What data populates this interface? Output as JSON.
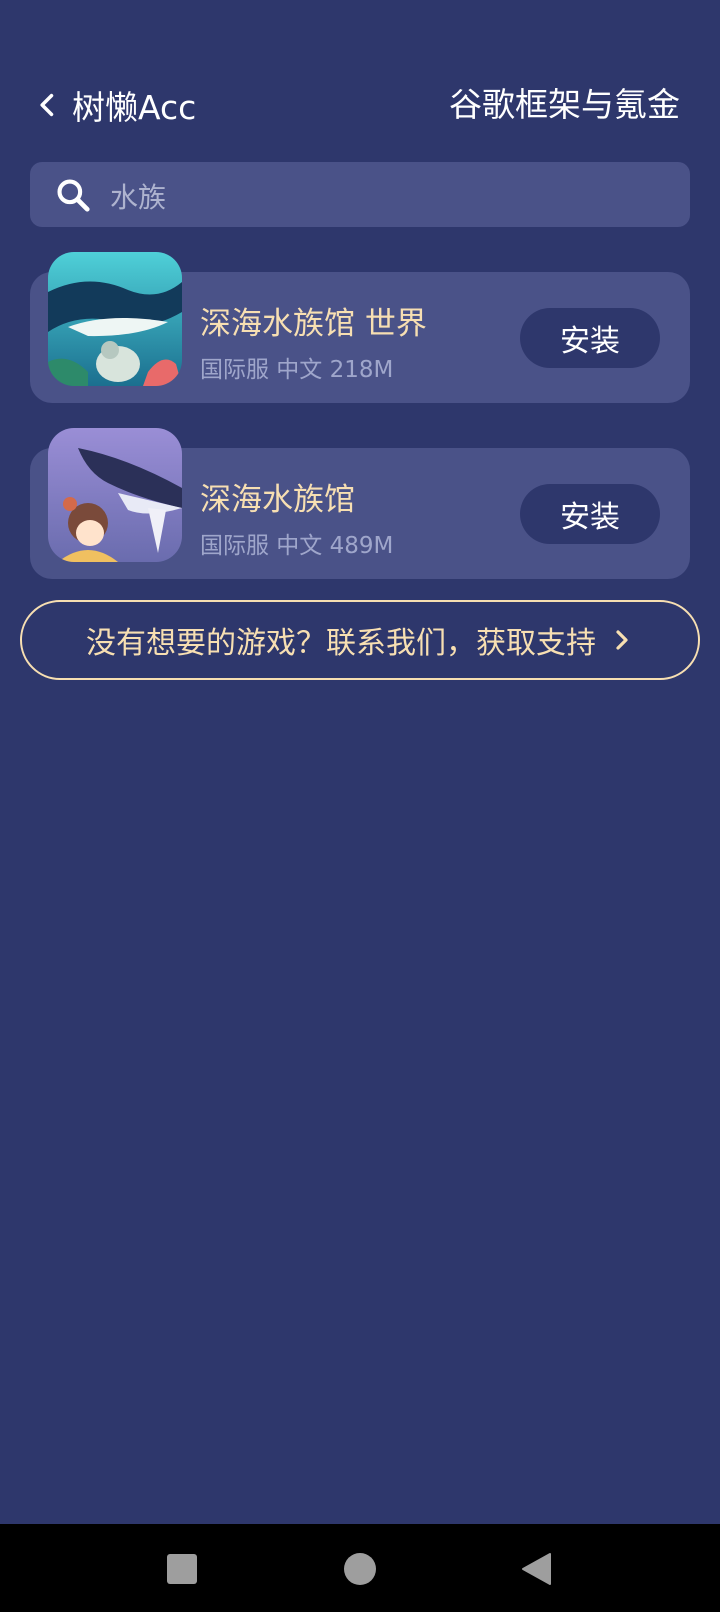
{
  "header": {
    "back_label": "树懒Acc",
    "right_title": "谷歌框架与氪金"
  },
  "search": {
    "value": "水族",
    "icon": "search-icon"
  },
  "games": [
    {
      "name": "深海水族馆 世界",
      "meta": "国际服 中文 218M",
      "install_label": "安装",
      "icon": "whale-game-icon"
    },
    {
      "name": "深海水族馆",
      "meta": "国际服 中文 489M",
      "install_label": "安装",
      "icon": "whale-girl-game-icon"
    }
  ],
  "support": {
    "label": "没有想要的游戏？联系我们，获取支持",
    "icon": "chevron-right-icon"
  },
  "navbar": {
    "recents_icon": "square-icon",
    "home_icon": "circle-icon",
    "back_icon": "triangle-back-icon"
  },
  "colors": {
    "background": "#2e376c",
    "card": "#4a5288",
    "accent": "#f7dfb2",
    "meta_text": "#9fa6cb"
  }
}
